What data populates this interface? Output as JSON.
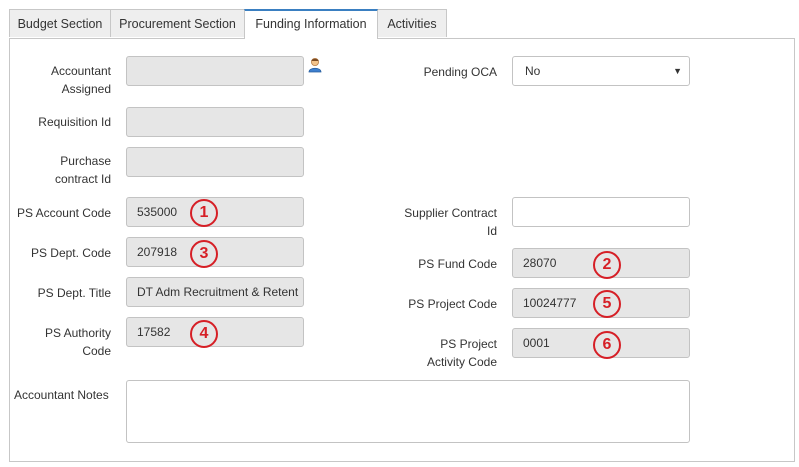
{
  "tabs": [
    "Budget Section",
    "Procurement Section",
    "Funding Information",
    "Activities"
  ],
  "left": {
    "accountant_assigned": {
      "label_line1": "Accountant",
      "label_line2": "Assigned",
      "value": ""
    },
    "requisition_id": {
      "label": "Requisition Id",
      "value": ""
    },
    "purchase_contract_id": {
      "label_line1": "Purchase",
      "label_line2": "contract Id",
      "value": ""
    },
    "ps_account_code": {
      "label": "PS Account Code",
      "value": "535000"
    },
    "ps_dept_code": {
      "label": "PS Dept. Code",
      "value": "207918"
    },
    "ps_dept_title": {
      "label": "PS Dept. Title",
      "value": "DT Adm Recruitment & Retent"
    },
    "ps_authority_code": {
      "label_line1": "PS Authority",
      "label_line2": "Code",
      "value": "17582"
    },
    "accountant_notes": {
      "label": "Accountant Notes",
      "value": ""
    }
  },
  "right": {
    "pending_oca": {
      "label": "Pending OCA",
      "value": "No"
    },
    "supplier_contract_id": {
      "label_line1": "Supplier Contract",
      "label_line2": "Id",
      "value": ""
    },
    "ps_fund_code": {
      "label": "PS Fund Code",
      "value": "28070"
    },
    "ps_project_code": {
      "label": "PS Project Code",
      "value": "10024777"
    },
    "ps_project_activity_code": {
      "label_line1": "PS Project",
      "label_line2": "Activity Code",
      "value": "0001"
    }
  },
  "badges": [
    "1",
    "2",
    "3",
    "4",
    "5",
    "6"
  ],
  "icons": {
    "accountant_lookup": "user-lookup-icon",
    "dropdown": "chevron-down-icon"
  },
  "colors": {
    "active_tab_border": "#3a7fc1",
    "badge": "#d61f26",
    "readonly_field": "#e6e6e6"
  }
}
